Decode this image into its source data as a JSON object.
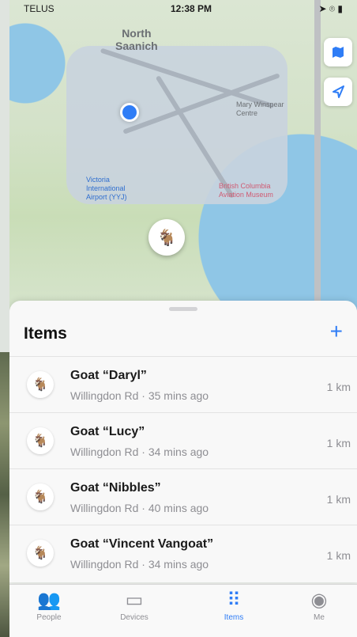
{
  "status_bar": {
    "carrier": "TELUS",
    "time": "12:38 PM",
    "right_icons": "➤ ⌾ ▮"
  },
  "map": {
    "region_label": "North\nSaanich",
    "poi_airport": "Victoria\nInternational\nAirport (YYJ)",
    "poi_museum": "British Columbia\nAviation Museum",
    "poi_centre": "Mary Winspear\nCentre",
    "map_button_icon": "map-icon",
    "locate_button_icon": "location-arrow-icon",
    "pin_icon": "goat-icon"
  },
  "items_panel": {
    "title": "Items",
    "add_label": "+",
    "items": [
      {
        "name": "Goat “Daryl”",
        "meta": "Willingdon Rd · 35 mins ago",
        "distance": "1 km"
      },
      {
        "name": "Goat “Lucy”",
        "meta": "Willingdon Rd · 34 mins ago",
        "distance": "1 km"
      },
      {
        "name": "Goat “Nibbles”",
        "meta": "Willingdon Rd · 40 mins ago",
        "distance": "1 km"
      },
      {
        "name": "Goat “Vincent Vangoat”",
        "meta": "Willingdon Rd · 34 mins ago",
        "distance": "1 km"
      }
    ]
  },
  "tabbar": {
    "tabs": [
      {
        "label": "People",
        "icon": "people-icon"
      },
      {
        "label": "Devices",
        "icon": "devices-icon"
      },
      {
        "label": "Items",
        "icon": "items-icon"
      },
      {
        "label": "Me",
        "icon": "me-icon"
      }
    ],
    "active_color": "#2f7df6"
  }
}
